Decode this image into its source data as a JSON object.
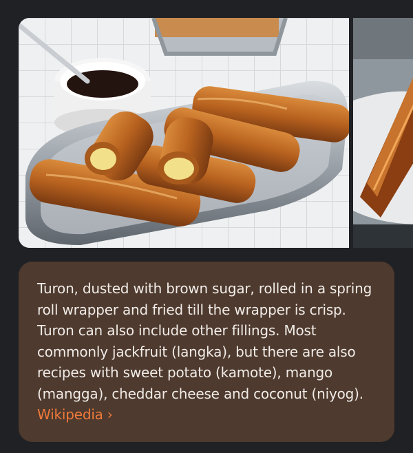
{
  "carousel": {
    "images": [
      {
        "subject": "turon-plate-photo"
      },
      {
        "subject": "turon-closeup-photo"
      }
    ]
  },
  "caption": {
    "text": "Turon, dusted with brown sugar, rolled in a spring roll wrapper and fried till the wrapper is crisp. Turon can also include other fillings. Most commonly jackfruit (langka), but there are also recipes with sweet potato (kamote), mango (mangga), cheddar cheese and coconut (niyog).",
    "source_label": "Wikipedia",
    "chevron": "›"
  },
  "colors": {
    "background": "#202124",
    "card": "#4e3a2e",
    "text": "#f1ece8",
    "link": "#f07a3a"
  },
  "icons": {
    "chevron": "chevron-right-icon"
  }
}
